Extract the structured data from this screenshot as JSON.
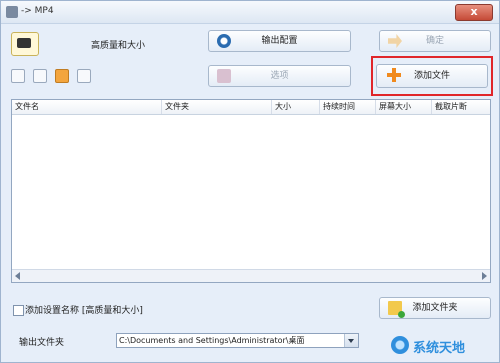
{
  "window": {
    "title": "-> MP4",
    "close_glyph": "x"
  },
  "profile": {
    "label": "高质量和大小",
    "icon": "video-profile-icon"
  },
  "toolbar_icons": [
    "add-file-icon",
    "remove-icon",
    "play-icon",
    "media-info-icon"
  ],
  "buttons": {
    "output_config": "输出配置",
    "ok": "确定",
    "options": "选项",
    "add_file": "添加文件",
    "add_folder": "添加文件夹"
  },
  "table": {
    "columns": [
      "文件名",
      "文件夹",
      "大小",
      "持续时间",
      "屏幕大小",
      "截取片断"
    ],
    "rows": []
  },
  "append_setting": {
    "label": "添加设置名称 [高质量和大小]",
    "checked": false
  },
  "output_folder": {
    "label": "输出文件夹",
    "path": "C:\\Documents and Settings\\Administrator\\桌面"
  },
  "watermark": {
    "text": "系统天地"
  },
  "colors": {
    "highlight": "#e0262a",
    "accent": "#f08a1e"
  }
}
